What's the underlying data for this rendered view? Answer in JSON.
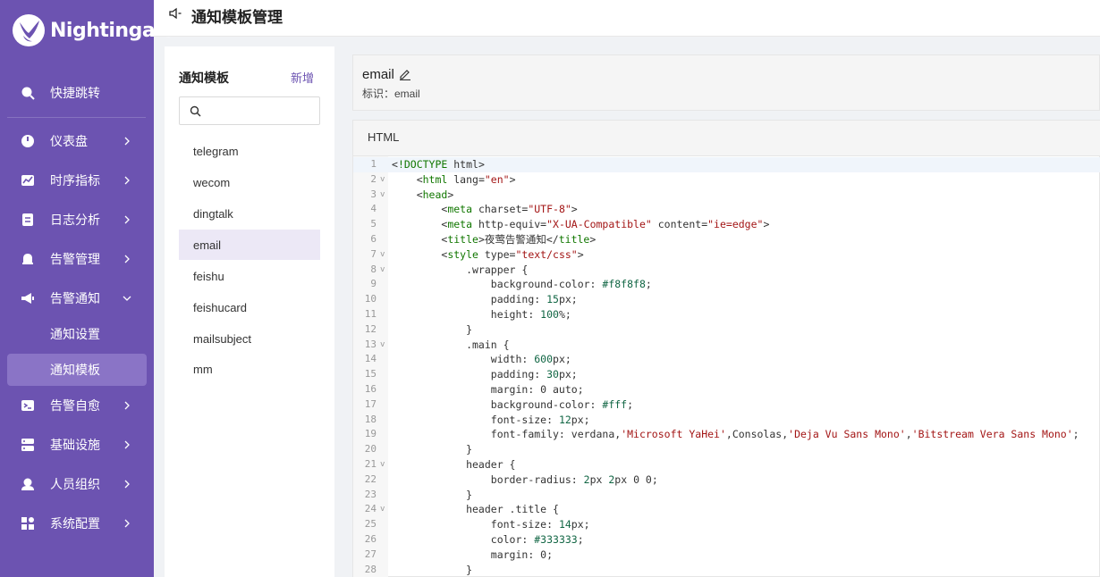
{
  "app": {
    "logo_text": "Nightingale"
  },
  "sidebar": {
    "items": [
      {
        "label": "快捷跳转",
        "icon": "search-icon"
      },
      {
        "label": "仪表盘",
        "icon": "dashboard-icon"
      },
      {
        "label": "时序指标",
        "icon": "line-chart-icon"
      },
      {
        "label": "日志分析",
        "icon": "log-icon"
      },
      {
        "label": "告警管理",
        "icon": "bell-icon"
      },
      {
        "label": "告警通知",
        "icon": "megaphone-icon"
      },
      {
        "label": "告警自愈",
        "icon": "terminal-icon"
      },
      {
        "label": "基础设施",
        "icon": "server-icon"
      },
      {
        "label": "人员组织",
        "icon": "user-icon"
      },
      {
        "label": "系统配置",
        "icon": "apps-icon"
      }
    ],
    "sub_items": [
      {
        "label": "通知设置"
      },
      {
        "label": "通知模板"
      }
    ]
  },
  "header": {
    "title": "通知模板管理"
  },
  "template_list": {
    "title": "通知模板",
    "add_label": "新增",
    "search_placeholder": "",
    "items": [
      "telegram",
      "wecom",
      "dingtalk",
      "email",
      "feishu",
      "feishucard",
      "mailsubject",
      "mm"
    ],
    "selected": "email"
  },
  "detail": {
    "name": "email",
    "id_label": "标识：email"
  },
  "editor": {
    "section_title": "HTML",
    "lines": [
      "<!DOCTYPE html>",
      "    <html lang=\"en\">",
      "    <head>",
      "        <meta charset=\"UTF-8\">",
      "        <meta http-equiv=\"X-UA-Compatible\" content=\"ie=edge\">",
      "        <title>夜莺告警通知</title>",
      "        <style type=\"text/css\">",
      "            .wrapper {",
      "                background-color: #f8f8f8;",
      "                padding: 15px;",
      "                height: 100%;",
      "            }",
      "            .main {",
      "                width: 600px;",
      "                padding: 30px;",
      "                margin: 0 auto;",
      "                background-color: #fff;",
      "                font-size: 12px;",
      "                font-family: verdana,'Microsoft YaHei',Consolas,'Deja Vu Sans Mono','Bitstream Vera Sans Mono';",
      "            }",
      "            header {",
      "                border-radius: 2px 2px 0 0;",
      "            }",
      "            header .title {",
      "                font-size: 14px;",
      "                color: #333333;",
      "                margin: 0;",
      "            }"
    ],
    "fold_lines": [
      2,
      3,
      7,
      8,
      13,
      21,
      24
    ]
  }
}
